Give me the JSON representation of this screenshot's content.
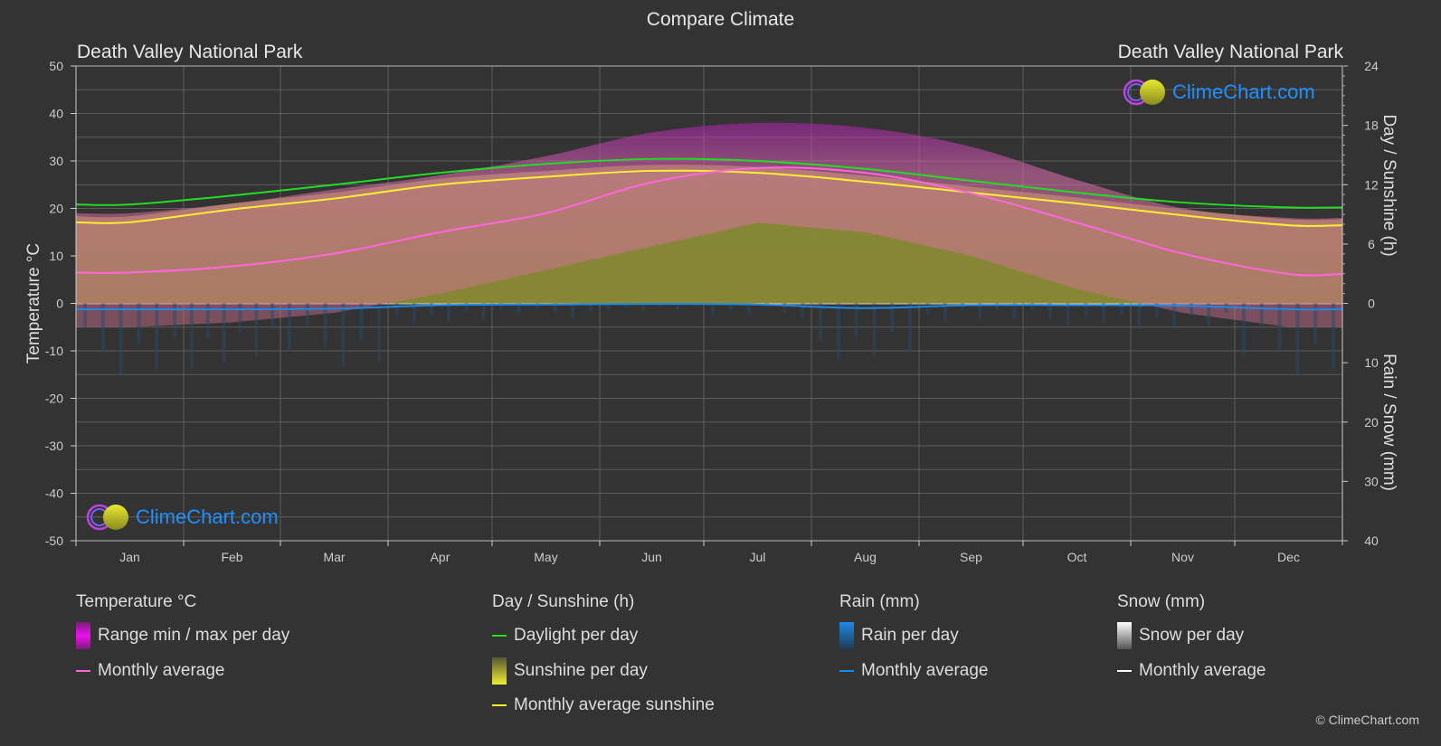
{
  "title": "Compare Climate",
  "location_left": "Death Valley National Park",
  "location_right": "Death Valley National Park",
  "logo_text": "ClimeChart.com",
  "copyright": "© ClimeChart.com",
  "colors": {
    "background": "#333333",
    "grid": "#5a5a5a",
    "daylight": "#22dd22",
    "sunshine_avg": "#ffee33",
    "temp_avg": "#ff66dd",
    "rain_avg": "#1e88e5",
    "snow_avg": "#ffffff",
    "logo": "#1e90ff"
  },
  "legend": {
    "temperature": {
      "heading": "Temperature °C",
      "items": [
        "Range min / max per day",
        "Monthly average"
      ]
    },
    "sunshine": {
      "heading": "Day / Sunshine (h)",
      "items": [
        "Daylight per day",
        "Sunshine per day",
        "Monthly average sunshine"
      ]
    },
    "rain": {
      "heading": "Rain (mm)",
      "items": [
        "Rain per day",
        "Monthly average"
      ]
    },
    "snow": {
      "heading": "Snow (mm)",
      "items": [
        "Snow per day",
        "Monthly average"
      ]
    }
  },
  "chart_data": {
    "type": "area",
    "title": "Compare Climate",
    "categories": [
      "Jan",
      "Feb",
      "Mar",
      "Apr",
      "May",
      "Jun",
      "Jul",
      "Aug",
      "Sep",
      "Oct",
      "Nov",
      "Dec"
    ],
    "axes": {
      "left": {
        "label": "Temperature °C",
        "range": [
          -50,
          50
        ],
        "ticks": [
          50,
          40,
          30,
          20,
          10,
          0,
          -10,
          -20,
          -30,
          -40,
          -50
        ]
      },
      "right_top": {
        "label": "Day / Sunshine (h)",
        "range": [
          0,
          24
        ],
        "ticks": [
          24,
          18,
          12,
          6,
          0
        ]
      },
      "right_bottom": {
        "label": "Rain / Snow (mm)",
        "range": [
          0,
          40
        ],
        "ticks": [
          10,
          20,
          30,
          40
        ]
      }
    },
    "grid": true,
    "series": [
      {
        "name": "Daylight per day",
        "unit": "h",
        "values": [
          10.0,
          10.9,
          12.0,
          13.2,
          14.1,
          14.6,
          14.4,
          13.6,
          12.4,
          11.2,
          10.2,
          9.7
        ]
      },
      {
        "name": "Monthly average sunshine",
        "unit": "h",
        "values": [
          8.2,
          9.5,
          10.6,
          12.0,
          12.8,
          13.4,
          13.2,
          12.3,
          11.2,
          10.1,
          8.9,
          7.9
        ]
      },
      {
        "name": "Temperature monthly average",
        "unit": "°C",
        "values": [
          6.5,
          7.8,
          10.5,
          15.0,
          19.0,
          25.5,
          28.5,
          27.5,
          23.2,
          17.0,
          10.5,
          6.2
        ]
      },
      {
        "name": "Temperature range max per day",
        "unit": "°C",
        "values": [
          19,
          21,
          24,
          27,
          31,
          36,
          38,
          37,
          33,
          26,
          20,
          18
        ]
      },
      {
        "name": "Temperature range min per day",
        "unit": "°C",
        "values": [
          -5,
          -4,
          -2,
          2,
          7,
          12,
          17,
          15,
          10,
          3,
          -2,
          -5
        ]
      },
      {
        "name": "Rain monthly average",
        "unit": "mm",
        "values": [
          1.0,
          1.0,
          0.9,
          0.3,
          0.2,
          0.1,
          0.2,
          0.8,
          0.3,
          0.3,
          0.4,
          1.0
        ]
      },
      {
        "name": "Snow monthly average",
        "unit": "mm",
        "values": [
          0,
          0,
          0,
          0,
          0,
          0,
          0,
          0,
          0,
          0,
          0,
          0
        ]
      }
    ]
  }
}
